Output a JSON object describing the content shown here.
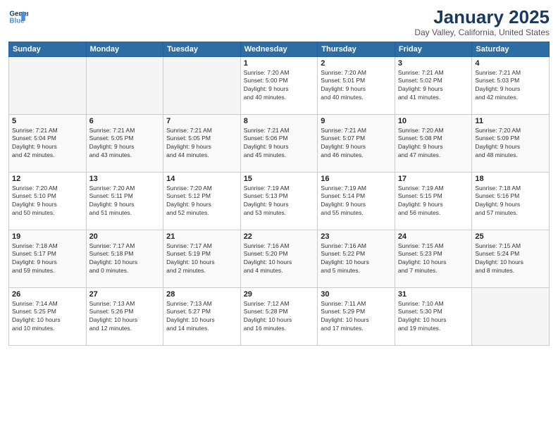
{
  "header": {
    "logo_line1": "General",
    "logo_line2": "Blue",
    "month": "January 2025",
    "location": "Day Valley, California, United States"
  },
  "weekdays": [
    "Sunday",
    "Monday",
    "Tuesday",
    "Wednesday",
    "Thursday",
    "Friday",
    "Saturday"
  ],
  "weeks": [
    [
      {
        "day": "",
        "info": ""
      },
      {
        "day": "",
        "info": ""
      },
      {
        "day": "",
        "info": ""
      },
      {
        "day": "1",
        "info": "Sunrise: 7:20 AM\nSunset: 5:00 PM\nDaylight: 9 hours\nand 40 minutes."
      },
      {
        "day": "2",
        "info": "Sunrise: 7:20 AM\nSunset: 5:01 PM\nDaylight: 9 hours\nand 40 minutes."
      },
      {
        "day": "3",
        "info": "Sunrise: 7:21 AM\nSunset: 5:02 PM\nDaylight: 9 hours\nand 41 minutes."
      },
      {
        "day": "4",
        "info": "Sunrise: 7:21 AM\nSunset: 5:03 PM\nDaylight: 9 hours\nand 42 minutes."
      }
    ],
    [
      {
        "day": "5",
        "info": "Sunrise: 7:21 AM\nSunset: 5:04 PM\nDaylight: 9 hours\nand 42 minutes."
      },
      {
        "day": "6",
        "info": "Sunrise: 7:21 AM\nSunset: 5:05 PM\nDaylight: 9 hours\nand 43 minutes."
      },
      {
        "day": "7",
        "info": "Sunrise: 7:21 AM\nSunset: 5:05 PM\nDaylight: 9 hours\nand 44 minutes."
      },
      {
        "day": "8",
        "info": "Sunrise: 7:21 AM\nSunset: 5:06 PM\nDaylight: 9 hours\nand 45 minutes."
      },
      {
        "day": "9",
        "info": "Sunrise: 7:21 AM\nSunset: 5:07 PM\nDaylight: 9 hours\nand 46 minutes."
      },
      {
        "day": "10",
        "info": "Sunrise: 7:20 AM\nSunset: 5:08 PM\nDaylight: 9 hours\nand 47 minutes."
      },
      {
        "day": "11",
        "info": "Sunrise: 7:20 AM\nSunset: 5:09 PM\nDaylight: 9 hours\nand 48 minutes."
      }
    ],
    [
      {
        "day": "12",
        "info": "Sunrise: 7:20 AM\nSunset: 5:10 PM\nDaylight: 9 hours\nand 50 minutes."
      },
      {
        "day": "13",
        "info": "Sunrise: 7:20 AM\nSunset: 5:11 PM\nDaylight: 9 hours\nand 51 minutes."
      },
      {
        "day": "14",
        "info": "Sunrise: 7:20 AM\nSunset: 5:12 PM\nDaylight: 9 hours\nand 52 minutes."
      },
      {
        "day": "15",
        "info": "Sunrise: 7:19 AM\nSunset: 5:13 PM\nDaylight: 9 hours\nand 53 minutes."
      },
      {
        "day": "16",
        "info": "Sunrise: 7:19 AM\nSunset: 5:14 PM\nDaylight: 9 hours\nand 55 minutes."
      },
      {
        "day": "17",
        "info": "Sunrise: 7:19 AM\nSunset: 5:15 PM\nDaylight: 9 hours\nand 56 minutes."
      },
      {
        "day": "18",
        "info": "Sunrise: 7:18 AM\nSunset: 5:16 PM\nDaylight: 9 hours\nand 57 minutes."
      }
    ],
    [
      {
        "day": "19",
        "info": "Sunrise: 7:18 AM\nSunset: 5:17 PM\nDaylight: 9 hours\nand 59 minutes."
      },
      {
        "day": "20",
        "info": "Sunrise: 7:17 AM\nSunset: 5:18 PM\nDaylight: 10 hours\nand 0 minutes."
      },
      {
        "day": "21",
        "info": "Sunrise: 7:17 AM\nSunset: 5:19 PM\nDaylight: 10 hours\nand 2 minutes."
      },
      {
        "day": "22",
        "info": "Sunrise: 7:16 AM\nSunset: 5:20 PM\nDaylight: 10 hours\nand 4 minutes."
      },
      {
        "day": "23",
        "info": "Sunrise: 7:16 AM\nSunset: 5:22 PM\nDaylight: 10 hours\nand 5 minutes."
      },
      {
        "day": "24",
        "info": "Sunrise: 7:15 AM\nSunset: 5:23 PM\nDaylight: 10 hours\nand 7 minutes."
      },
      {
        "day": "25",
        "info": "Sunrise: 7:15 AM\nSunset: 5:24 PM\nDaylight: 10 hours\nand 8 minutes."
      }
    ],
    [
      {
        "day": "26",
        "info": "Sunrise: 7:14 AM\nSunset: 5:25 PM\nDaylight: 10 hours\nand 10 minutes."
      },
      {
        "day": "27",
        "info": "Sunrise: 7:13 AM\nSunset: 5:26 PM\nDaylight: 10 hours\nand 12 minutes."
      },
      {
        "day": "28",
        "info": "Sunrise: 7:13 AM\nSunset: 5:27 PM\nDaylight: 10 hours\nand 14 minutes."
      },
      {
        "day": "29",
        "info": "Sunrise: 7:12 AM\nSunset: 5:28 PM\nDaylight: 10 hours\nand 16 minutes."
      },
      {
        "day": "30",
        "info": "Sunrise: 7:11 AM\nSunset: 5:29 PM\nDaylight: 10 hours\nand 17 minutes."
      },
      {
        "day": "31",
        "info": "Sunrise: 7:10 AM\nSunset: 5:30 PM\nDaylight: 10 hours\nand 19 minutes."
      },
      {
        "day": "",
        "info": ""
      }
    ]
  ]
}
